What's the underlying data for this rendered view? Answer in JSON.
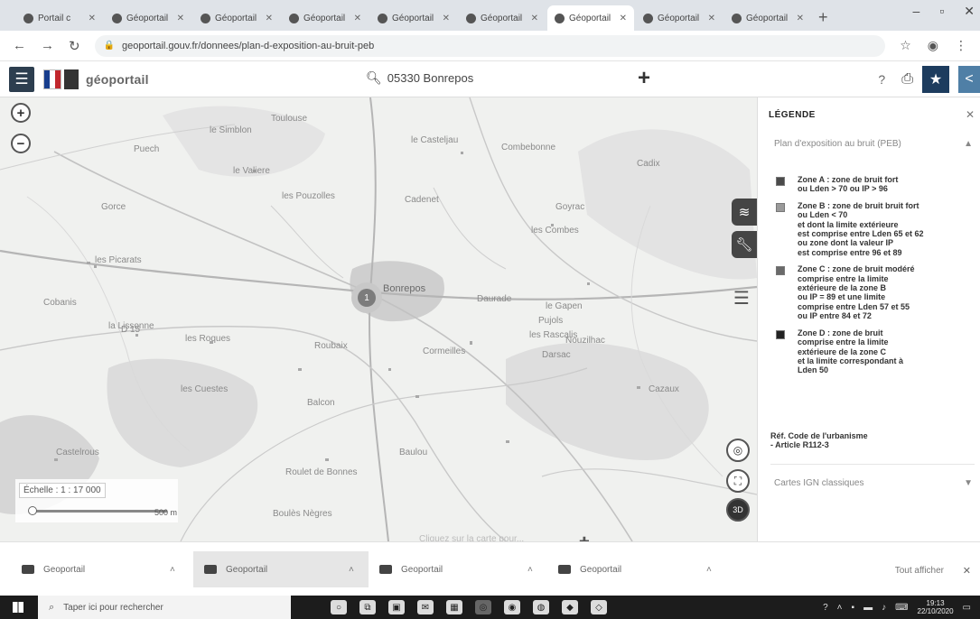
{
  "browser": {
    "tabs": [
      {
        "title": "Portail c",
        "active": false
      },
      {
        "title": "Géoportail",
        "active": false
      },
      {
        "title": "Géoportail",
        "active": false
      },
      {
        "title": "Géoportail",
        "active": false
      },
      {
        "title": "Géoportail",
        "active": false
      },
      {
        "title": "Géoportail",
        "active": false
      },
      {
        "title": "Géoportail",
        "active": true
      },
      {
        "title": "Géoportail",
        "active": false
      },
      {
        "title": "Géoportail",
        "active": false
      }
    ],
    "url": "geoportail.gouv.fr/donnees/plan-d-exposition-au-bruit-peb"
  },
  "header": {
    "brand": "géoportail",
    "search_text": "05330 Bonrepos"
  },
  "map": {
    "labels": [
      {
        "text": "le Simblon"
      },
      {
        "text": "Toulouse"
      },
      {
        "text": "Puech"
      },
      {
        "text": "le Casteljau"
      },
      {
        "text": "Combebonne"
      },
      {
        "text": "Cadix"
      },
      {
        "text": "le Valiere"
      },
      {
        "text": "les Pouzolles"
      },
      {
        "text": "Cadenet"
      },
      {
        "text": "Goyrac"
      },
      {
        "text": "les Combes"
      },
      {
        "text": "Gorce"
      },
      {
        "text": "Bonrepos"
      },
      {
        "text": "Daurade"
      },
      {
        "text": "le Gapen"
      },
      {
        "text": "Pujols"
      },
      {
        "text": "les Rascalis"
      },
      {
        "text": "Nouzilhac"
      },
      {
        "text": "Darsac"
      },
      {
        "text": "la Lissonne"
      },
      {
        "text": "D 15"
      },
      {
        "text": "les Roques"
      },
      {
        "text": "Roubaix"
      },
      {
        "text": "Cormeilles"
      },
      {
        "text": "les Picarats"
      },
      {
        "text": "Cobanis"
      },
      {
        "text": "les Cuestes"
      },
      {
        "text": "Balcon"
      },
      {
        "text": "Castelrous"
      },
      {
        "text": "Baulou"
      },
      {
        "text": "Roulet de Bonnes"
      },
      {
        "text": "Boulès Nègres"
      },
      {
        "text": "Cazaux"
      }
    ],
    "pin_number": "1",
    "scale_label": "Échelle : 1 : 17 000",
    "scale_distance": "500 m",
    "coords_text": "Cliquez sur la carte pour...",
    "layers_count": "2"
  },
  "legend": {
    "title": "LÉGENDE",
    "layer_name": "Plan d'exposition au bruit (PEB)",
    "items": [
      {
        "color": "#4a4a4a",
        "lines": [
          "Zone A : zone de bruit fort",
          "ou Lden > 70 ou IP > 96"
        ]
      },
      {
        "color": "#9a9a9a",
        "lines": [
          "Zone B : zone de bruit bruit fort",
          "ou Lden < 70",
          "et dont la limite extérieure",
          "est comprise entre Lden 65 et 62",
          "ou zone dont la valeur IP",
          "est comprise entre 96 et 89"
        ]
      },
      {
        "color": "#6a6a6a",
        "lines": [
          "Zone C : zone de bruit modéré",
          "comprise entre la limite",
          "extérieure de la zone B",
          "ou IP = 89 et une limite",
          "comprise entre Lden 57 et 55",
          "ou IP entre 84 et 72"
        ]
      },
      {
        "color": "#222222",
        "lines": [
          "Zone D : zone de bruit",
          "comprise entre la limite",
          "extérieure de la zone C",
          "et la limite correspondant à",
          "Lden 50"
        ]
      }
    ],
    "reference": [
      "Réf. Code de l'urbanisme",
      "- Article R112-3"
    ],
    "layer2_name": "Cartes IGN classiques"
  },
  "downloads": {
    "items": [
      {
        "name": "Geoportail"
      },
      {
        "name": "Geoportail"
      },
      {
        "name": "Geoportail"
      },
      {
        "name": "Geoportail"
      }
    ],
    "show_all": "Tout afficher"
  },
  "taskbar": {
    "search_placeholder": "Taper ici pour rechercher",
    "time": "19:13",
    "date": "22/10/2020"
  }
}
